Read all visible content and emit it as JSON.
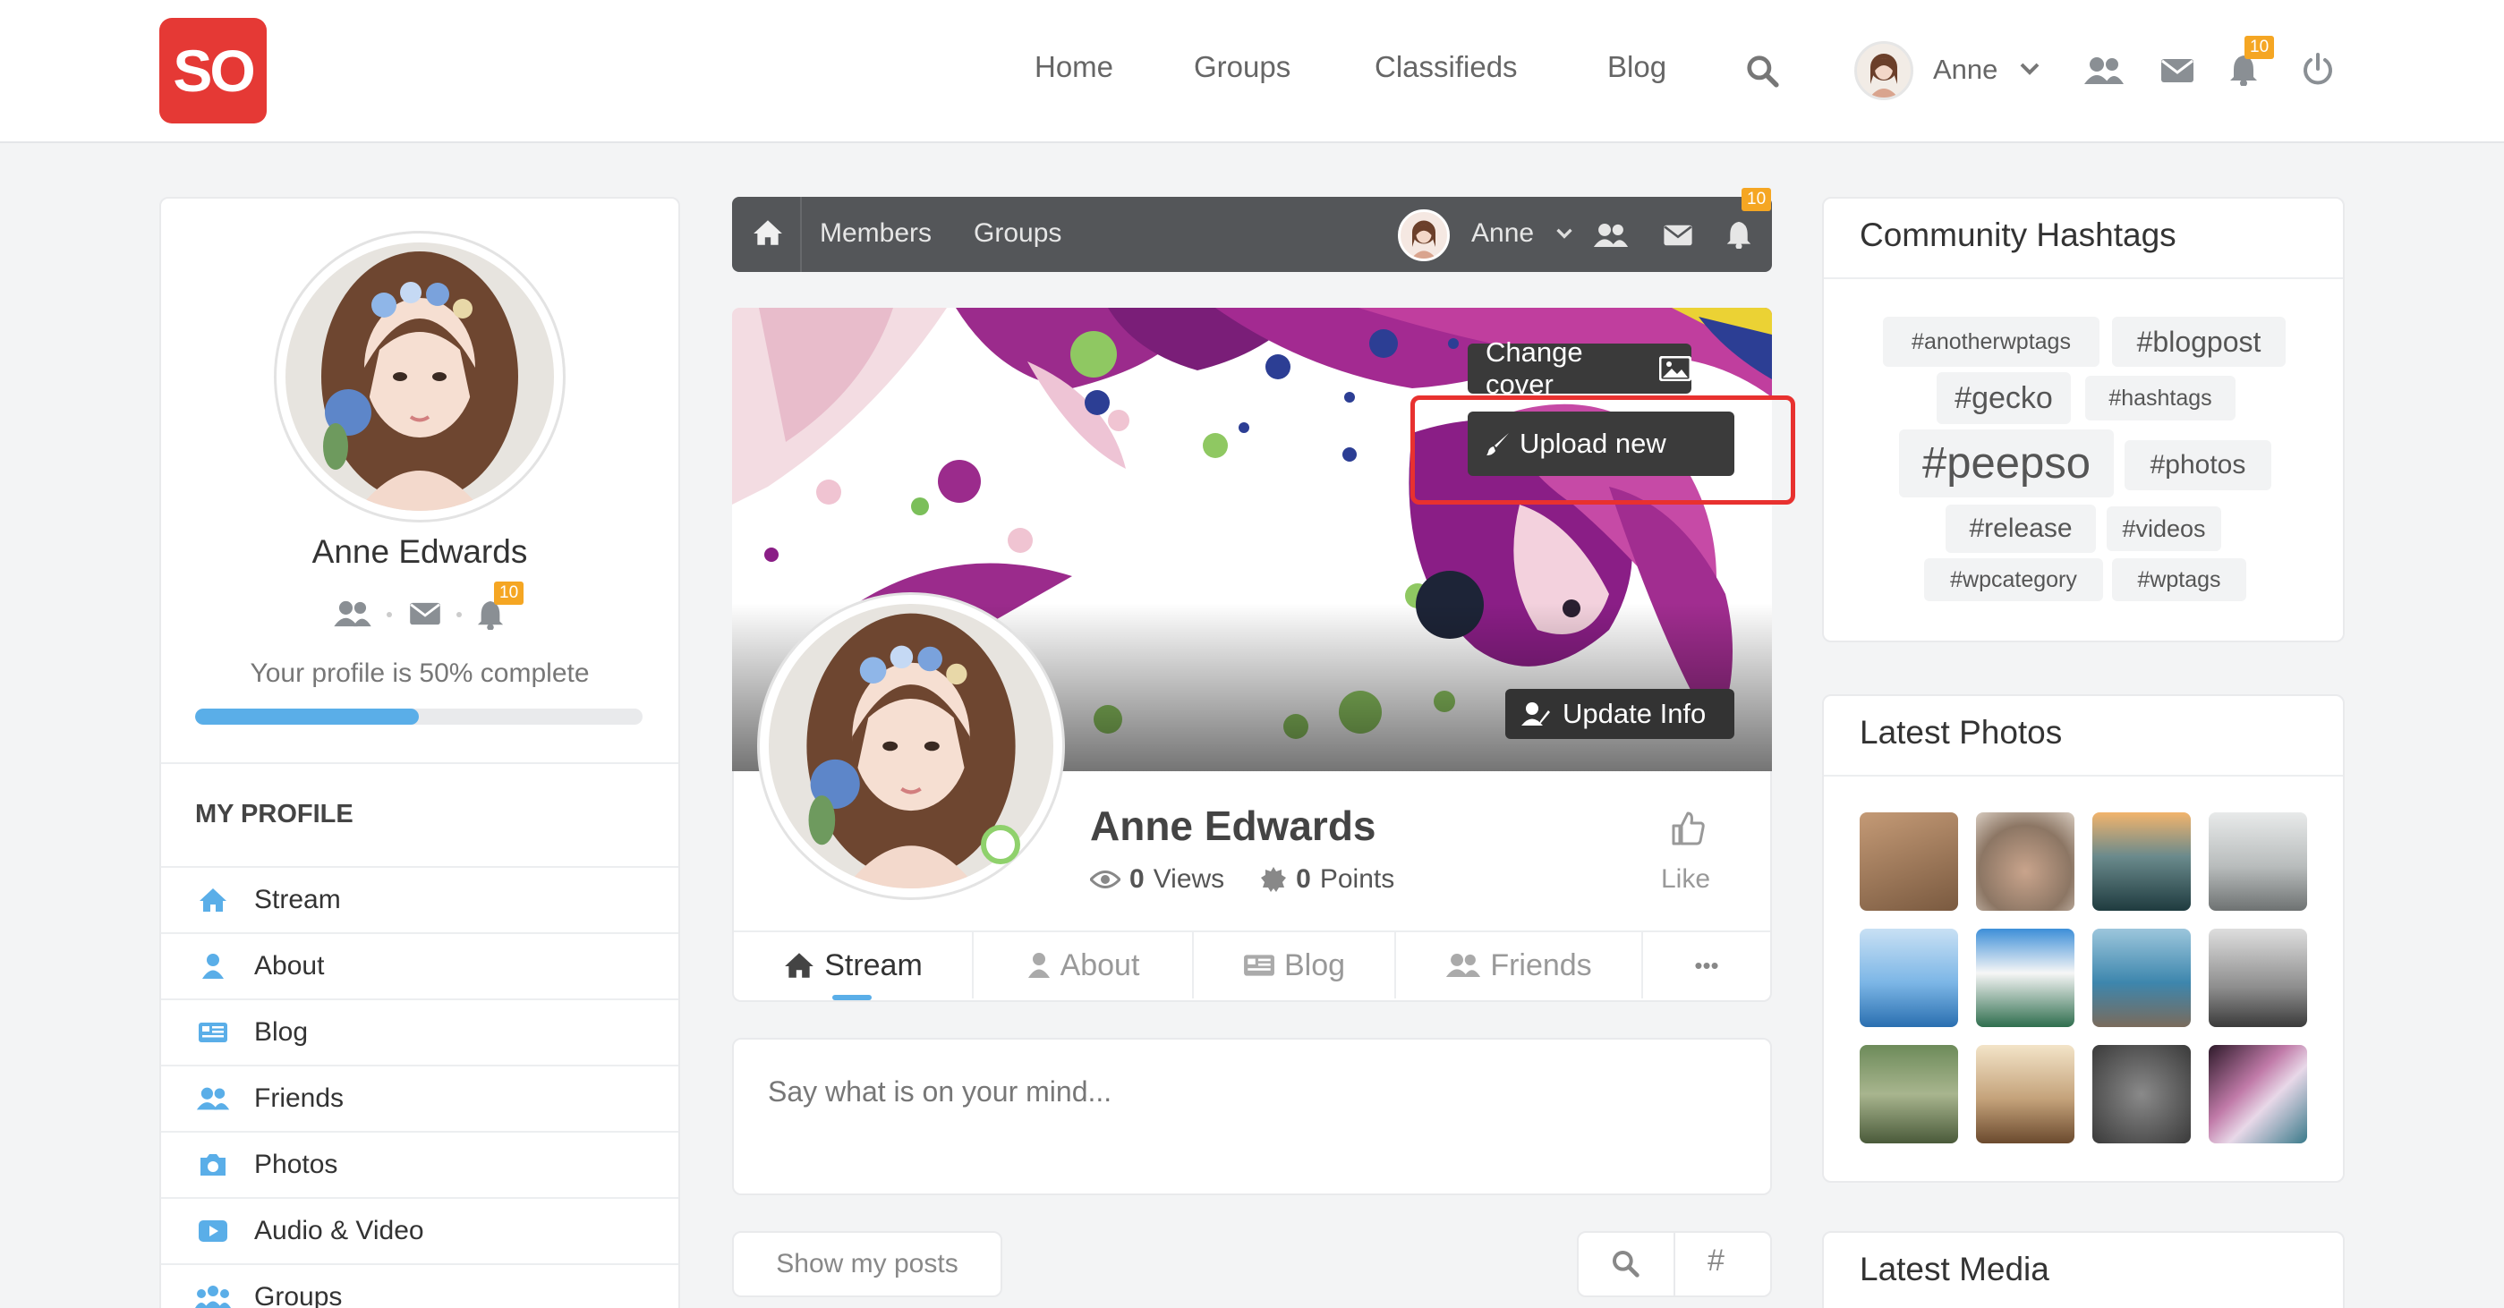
{
  "header": {
    "logo": "SO",
    "nav": [
      "Home",
      "Groups",
      "Classifieds",
      "Blog"
    ],
    "user_name": "Anne",
    "notification_count": "10"
  },
  "left": {
    "name": "Anne Edwards",
    "notification_count": "10",
    "completeness_text": "Your profile is 50% complete",
    "completeness_value": 50,
    "section_title": "MY PROFILE",
    "menu": [
      "Stream",
      "About",
      "Blog",
      "Friends",
      "Photos",
      "Audio & Video",
      "Groups"
    ]
  },
  "profile_bar": {
    "links": [
      "Members",
      "Groups"
    ],
    "user_name": "Anne",
    "notification_count": "10"
  },
  "cover": {
    "change_cover": "Change cover",
    "upload_new": "Upload new",
    "update_info": "Update Info"
  },
  "profile": {
    "name": "Anne Edwards",
    "views": "0",
    "views_label": "Views",
    "points": "0",
    "points_label": "Points",
    "like_label": "Like",
    "tabs": [
      "Stream",
      "About",
      "Blog",
      "Friends"
    ],
    "more": "•••"
  },
  "composer": {
    "placeholder": "Say what is on your mind..."
  },
  "filter": {
    "show_posts": "Show my posts",
    "hash": "#"
  },
  "right": {
    "hashtags_title": "Community Hashtags",
    "hashtags": [
      "#anotherwptags",
      "#blogpost",
      "#gecko",
      "#hashtags",
      "#peepso",
      "#photos",
      "#release",
      "#videos",
      "#wpcategory",
      "#wptags"
    ],
    "photos_title": "Latest Photos",
    "media_title": "Latest Media"
  },
  "colors": {
    "brand": "#e53935",
    "accent": "#5aaee8",
    "badge": "#f5a623",
    "highlight": "#e8312f"
  }
}
